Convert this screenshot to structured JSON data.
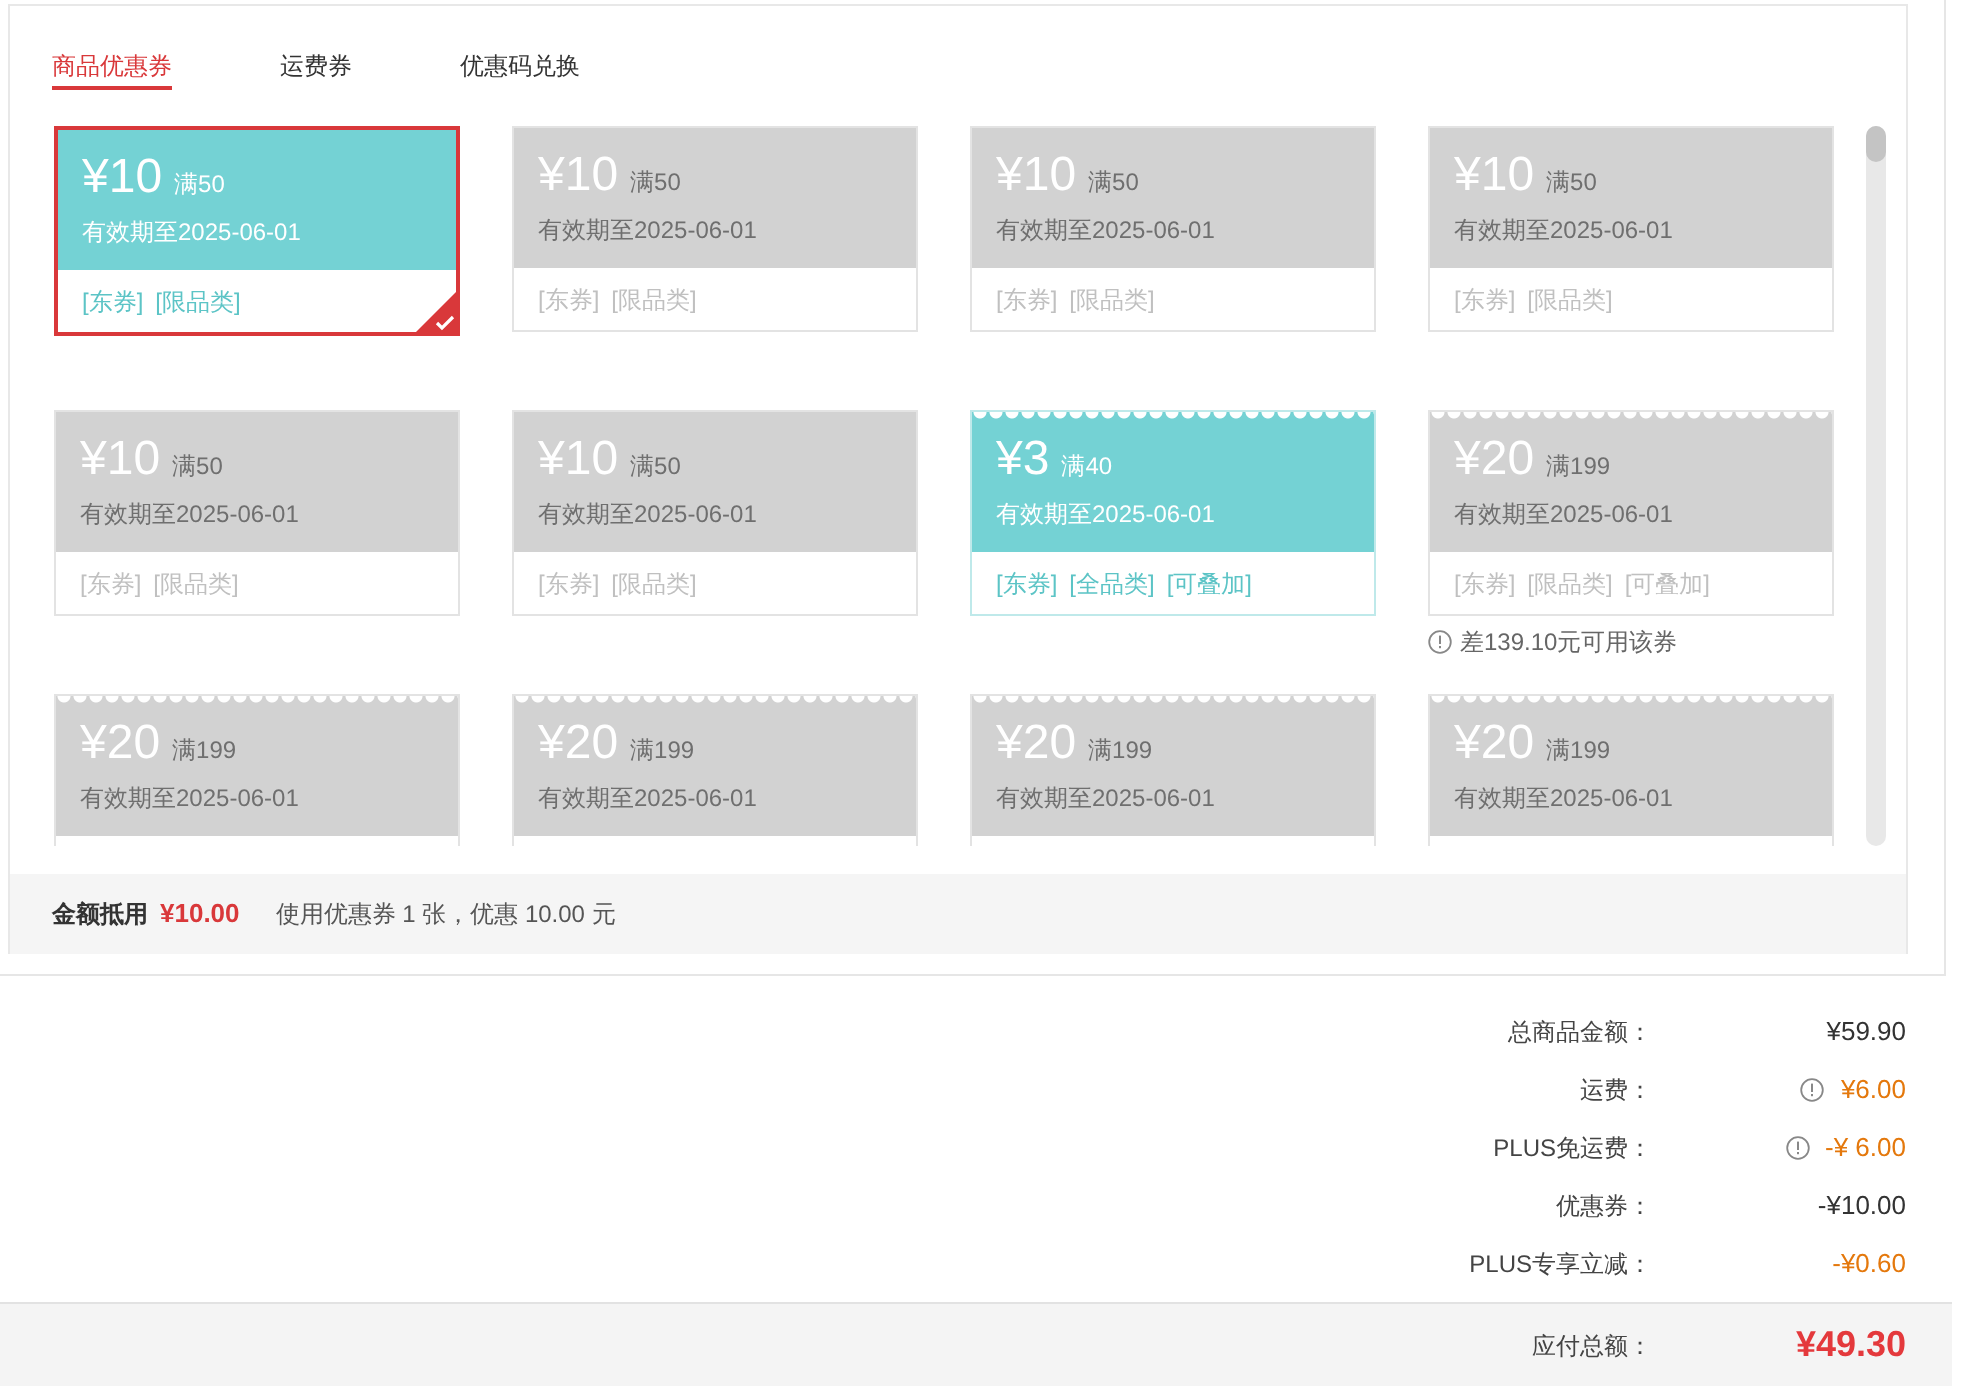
{
  "tabs": [
    {
      "label": "商品优惠券",
      "selected": true
    },
    {
      "label": "运费券",
      "selected": false
    },
    {
      "label": "优惠码兑换",
      "selected": false
    }
  ],
  "coupons": [
    {
      "amount": "¥10",
      "threshold": "满50",
      "expiry": "有效期至2025-06-01",
      "tags": [
        "[东券]",
        "[限品类]"
      ],
      "usable": true,
      "selected": true,
      "kind": "plain"
    },
    {
      "amount": "¥10",
      "threshold": "满50",
      "expiry": "有效期至2025-06-01",
      "tags": [
        "[东券]",
        "[限品类]"
      ],
      "usable": false,
      "selected": false,
      "kind": "plain"
    },
    {
      "amount": "¥10",
      "threshold": "满50",
      "expiry": "有效期至2025-06-01",
      "tags": [
        "[东券]",
        "[限品类]"
      ],
      "usable": false,
      "selected": false,
      "kind": "plain"
    },
    {
      "amount": "¥10",
      "threshold": "满50",
      "expiry": "有效期至2025-06-01",
      "tags": [
        "[东券]",
        "[限品类]"
      ],
      "usable": false,
      "selected": false,
      "kind": "plain"
    },
    {
      "amount": "¥10",
      "threshold": "满50",
      "expiry": "有效期至2025-06-01",
      "tags": [
        "[东券]",
        "[限品类]"
      ],
      "usable": false,
      "selected": false,
      "kind": "plain"
    },
    {
      "amount": "¥10",
      "threshold": "满50",
      "expiry": "有效期至2025-06-01",
      "tags": [
        "[东券]",
        "[限品类]"
      ],
      "usable": false,
      "selected": false,
      "kind": "plain"
    },
    {
      "amount": "¥3",
      "threshold": "满40",
      "expiry": "有效期至2025-06-01",
      "tags": [
        "[东券]",
        "[全品类]",
        "[可叠加]"
      ],
      "usable": true,
      "selected": false,
      "kind": "scalloped"
    },
    {
      "amount": "¥20",
      "threshold": "满199",
      "expiry": "有效期至2025-06-01",
      "tags": [
        "[东券]",
        "[限品类]",
        "[可叠加]"
      ],
      "usable": false,
      "selected": false,
      "kind": "scalloped",
      "note": "差139.10元可用该券"
    },
    {
      "amount": "¥20",
      "threshold": "满199",
      "expiry": "有效期至2025-06-01",
      "usable": false,
      "selected": false,
      "kind": "scalloped"
    },
    {
      "amount": "¥20",
      "threshold": "满199",
      "expiry": "有效期至2025-06-01",
      "usable": false,
      "selected": false,
      "kind": "scalloped"
    },
    {
      "amount": "¥20",
      "threshold": "满199",
      "expiry": "有效期至2025-06-01",
      "usable": false,
      "selected": false,
      "kind": "scalloped"
    },
    {
      "amount": "¥20",
      "threshold": "满199",
      "expiry": "有效期至2025-06-01",
      "usable": false,
      "selected": false,
      "kind": "scalloped"
    }
  ],
  "footer": {
    "label": "金额抵用",
    "amount": "¥10.00",
    "summary": "使用优惠券 1 张，优惠 10.00 元"
  },
  "summary": [
    {
      "label": "总商品金额：",
      "value": "¥59.90",
      "color": "#333333",
      "info": false
    },
    {
      "label": "运费：",
      "value": "¥6.00",
      "color": "#e4780c",
      "info": true
    },
    {
      "label": "PLUS免运费：",
      "value": "-¥ 6.00",
      "color": "#e4780c",
      "info": true
    },
    {
      "label": "优惠券：",
      "value": "-¥10.00",
      "color": "#333333",
      "info": false
    },
    {
      "label": "PLUS专享立减：",
      "value": "-¥0.60",
      "color": "#e4780c",
      "info": false
    }
  ],
  "total": {
    "label": "应付总额：",
    "value": "¥49.30"
  }
}
